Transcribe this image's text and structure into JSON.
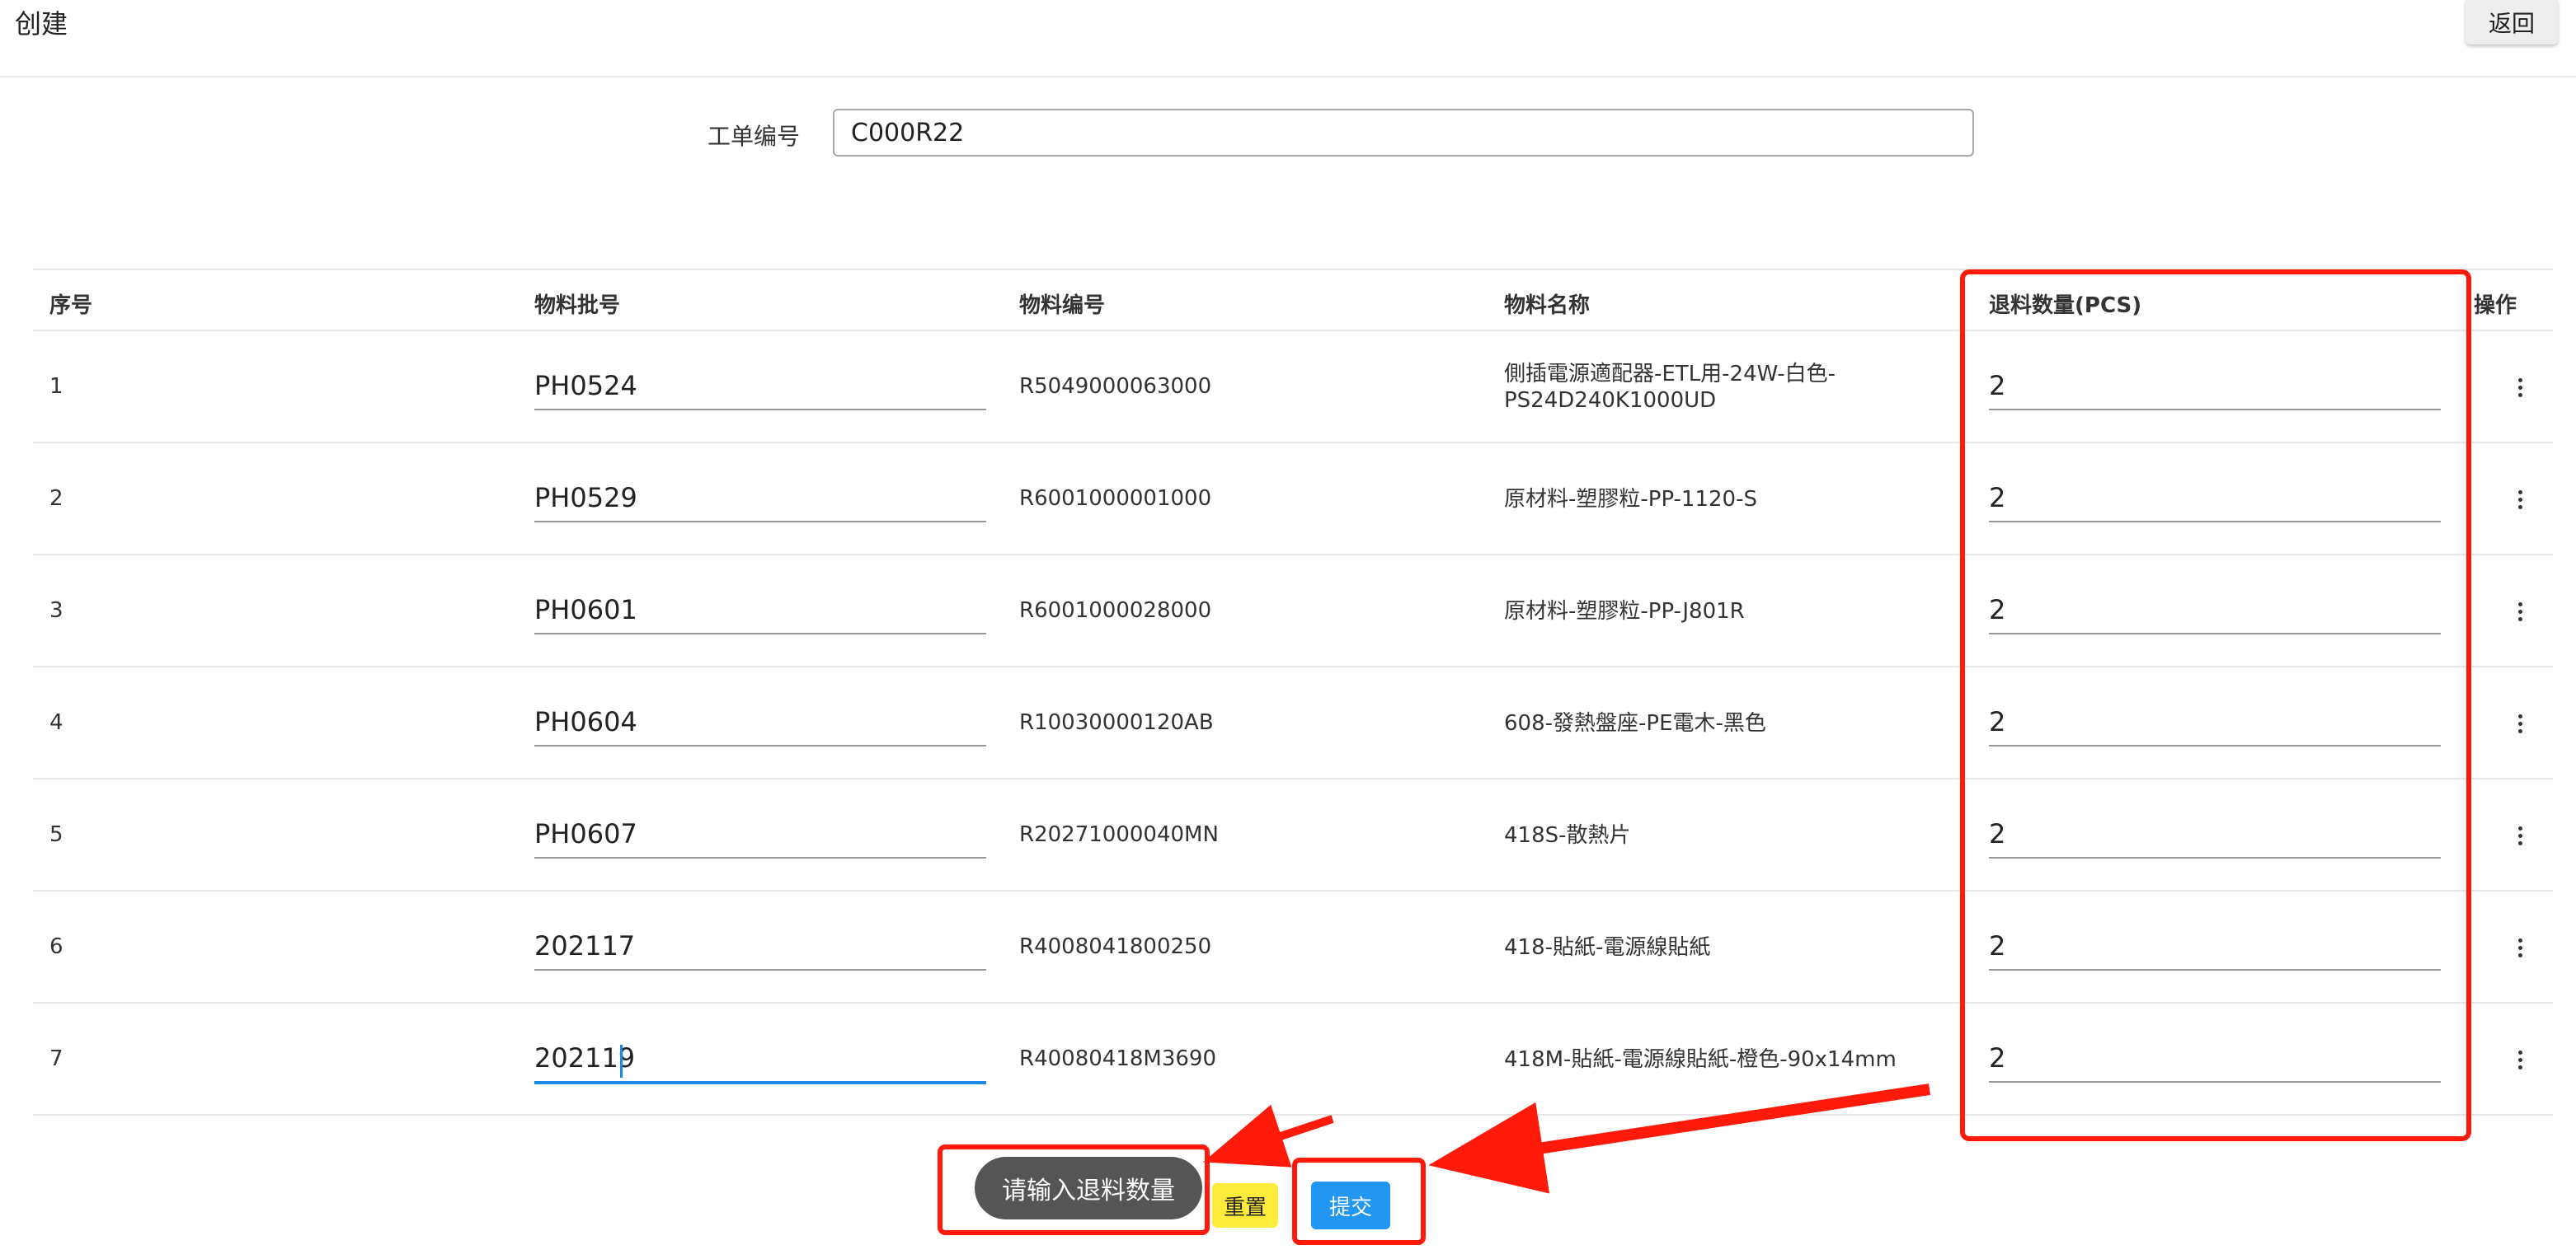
{
  "header": {
    "title": "创建",
    "back_label": "返回"
  },
  "order": {
    "label": "工单编号",
    "value": "C000R22"
  },
  "table": {
    "columns": [
      "序号",
      "物料批号",
      "物料编号",
      "物料名称",
      "退料数量(PCS)",
      "操作"
    ],
    "rows": [
      {
        "seq": "1",
        "batch": "PH0524",
        "code": "R5049000063000",
        "name": "側插電源適配器-ETL用-24W-白色-PS24D240K1000UD",
        "qty": "2"
      },
      {
        "seq": "2",
        "batch": "PH0529",
        "code": "R6001000001000",
        "name": "原材料-塑膠粒-PP-1120-S",
        "qty": "2"
      },
      {
        "seq": "3",
        "batch": "PH0601",
        "code": "R6001000028000",
        "name": "原材料-塑膠粒-PP-J801R",
        "qty": "2"
      },
      {
        "seq": "4",
        "batch": "PH0604",
        "code": "R10030000120AB",
        "name": "608-發熱盤座-PE電木-黑色",
        "qty": "2"
      },
      {
        "seq": "5",
        "batch": "PH0607",
        "code": "R20271000040MN",
        "name": "418S-散熱片",
        "qty": "2"
      },
      {
        "seq": "6",
        "batch": "202117",
        "code": "R4008041800250",
        "name": "418-貼紙-電源線貼紙",
        "qty": "2"
      },
      {
        "seq": "7",
        "batch": "202119",
        "code": "R40080418M3690",
        "name": "418M-貼紙-電源線貼紙-橙色-90x14mm",
        "qty": "2"
      }
    ]
  },
  "footer": {
    "toast": "请输入退料数量",
    "reset_label": "重置",
    "submit_label": "提交"
  },
  "colors": {
    "primary": "#2196f3",
    "warning": "#ffeb3b",
    "annotation": "#ff1a0a",
    "toast_bg": "#555555"
  },
  "icons": {
    "row_action": "more-vert-icon"
  }
}
